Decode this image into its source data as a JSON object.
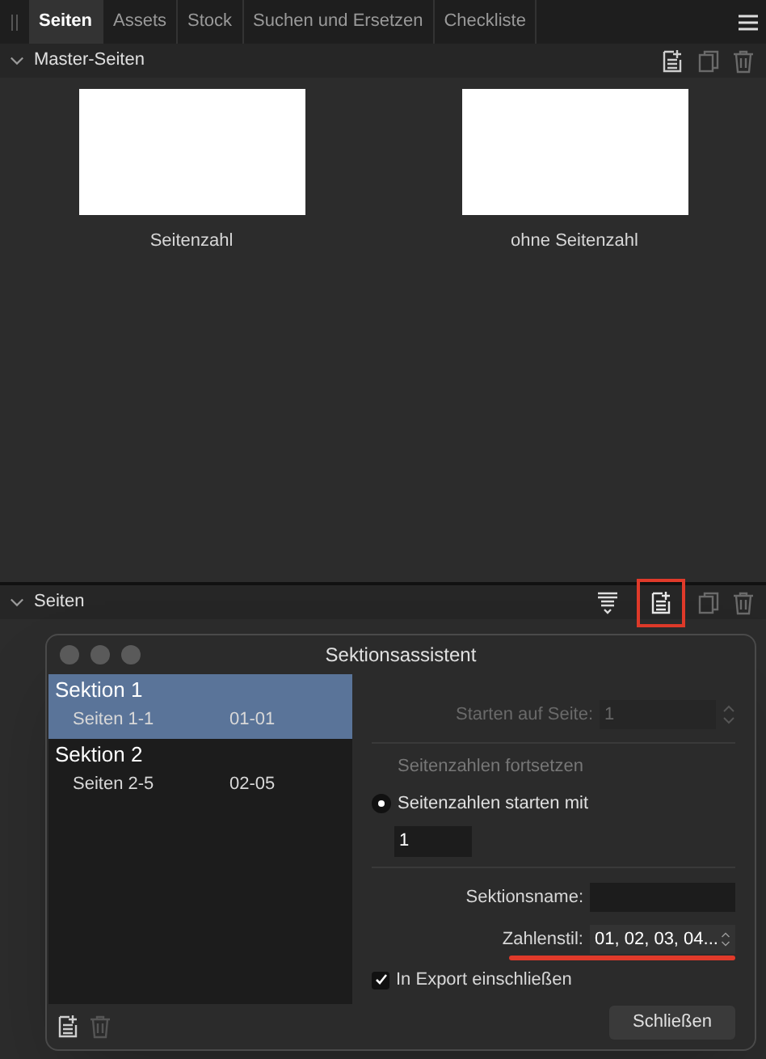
{
  "tabs": [
    {
      "label": "Seiten",
      "selected": true
    },
    {
      "label": "Assets",
      "selected": false
    },
    {
      "label": "Stock",
      "selected": false
    },
    {
      "label": "Suchen und Ersetzen",
      "selected": false
    },
    {
      "label": "Checkliste",
      "selected": false
    }
  ],
  "master_pages": {
    "title": "Master-Seiten",
    "expanded": true,
    "items": [
      {
        "label": "Seitenzahl"
      },
      {
        "label": "ohne Seitenzahl"
      }
    ]
  },
  "pages": {
    "title": "Seiten",
    "expanded": true
  },
  "dialog": {
    "title": "Sektionsassistent",
    "sections": [
      {
        "title": "Sektion 1",
        "range": "Seiten 1-1",
        "numbers": "01-01",
        "selected": true
      },
      {
        "title": "Sektion 2",
        "range": "Seiten 2-5",
        "numbers": "02-05",
        "selected": false
      }
    ],
    "start_on_page": {
      "label": "Starten auf Seite:",
      "value": "1",
      "disabled": true
    },
    "numbering": [
      {
        "label": "Seitenzahlen fortsetzen",
        "selected": false
      },
      {
        "label": "Seitenzahlen starten mit",
        "selected": true
      }
    ],
    "start_number": "1",
    "section_name": {
      "label": "Sektionsname:"
    },
    "number_style": {
      "label": "Zahlenstil:",
      "value": "01, 02, 03, 04..."
    },
    "include_export": {
      "label": "In Export einschließen",
      "checked": true
    },
    "close_button": "Schließen"
  }
}
